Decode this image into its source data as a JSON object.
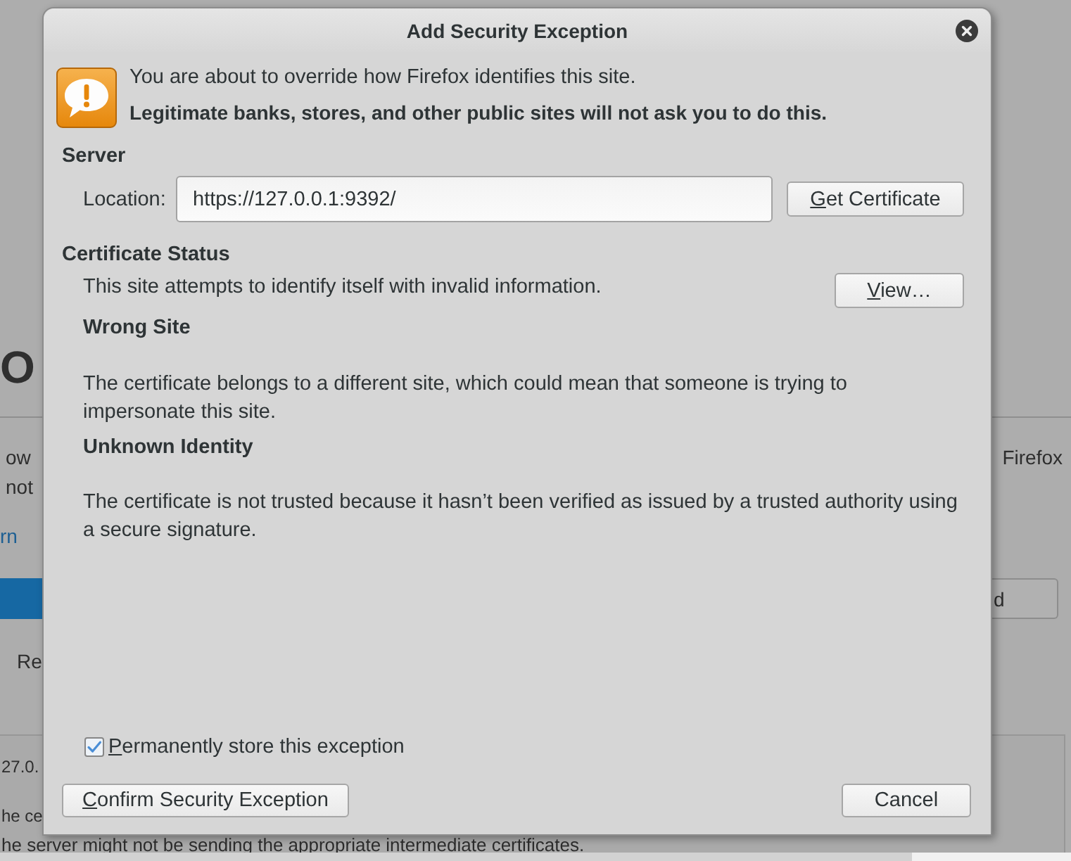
{
  "background_page": {
    "heading": "O",
    "description_left": [
      "ow",
      "not"
    ],
    "description_right": "Firefox",
    "link": "rn",
    "buttons": [
      {
        "kind": "primary"
      },
      {
        "kind": "secondary",
        "label": "d"
      }
    ],
    "checkbox_label": "Re",
    "details_panel": {
      "lines": [
        "27.0.",
        "he ce",
        "he server might not be sending the appropriate intermediate certificates."
      ]
    }
  },
  "dialog": {
    "title": "Add Security Exception",
    "intro": "You are about to override how Firefox identifies this site.",
    "warning": "Legitimate banks, stores, and other public sites will not ask you to do this.",
    "server": {
      "heading": "Server",
      "location_label": "Location:",
      "location_value": "https://127.0.0.1:9392/",
      "button": {
        "label": "Get Certificate",
        "mnemonic_underlined": true
      }
    },
    "certificate_status": {
      "heading": "Certificate Status",
      "summary": "This site attempts to identify itself with invalid information.",
      "button": {
        "label": "View…",
        "mnemonic_underlined": true
      },
      "problems": [
        {
          "title": "Wrong Site",
          "description": "The certificate belongs to a different site, which could mean that someone is trying to impersonate this site."
        },
        {
          "title": "Unknown Identity",
          "description": "The certificate is not trusted because it hasn’t been verified as issued by a trusted authority using a secure signature."
        }
      ]
    },
    "permanent_checkbox": {
      "label": "Permanently store this exception",
      "checked": true,
      "mnemonic_underlined": true
    },
    "buttons": [
      {
        "label": "Confirm Security Exception",
        "mnemonic_underlined": true
      },
      {
        "label": "Cancel",
        "mnemonic_underlined": false
      }
    ]
  }
}
